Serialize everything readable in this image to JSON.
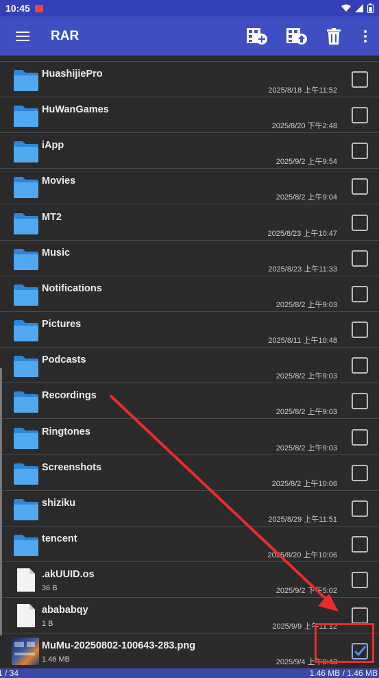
{
  "status_bar": {
    "time": "10:45"
  },
  "app_bar": {
    "title": "RAR",
    "actions": [
      "add-to-archive-icon",
      "extract-icon",
      "delete-icon",
      "more-vert-icon"
    ]
  },
  "files": [
    {
      "name": "HuashijiePro",
      "date": "2025/8/18 上午11:52",
      "size": "",
      "type": "folder",
      "checked": false
    },
    {
      "name": "HuWanGames",
      "date": "2025/8/20 下午2:48",
      "size": "",
      "type": "folder",
      "checked": false
    },
    {
      "name": "iApp",
      "date": "2025/9/2 上午9:54",
      "size": "",
      "type": "folder",
      "checked": false
    },
    {
      "name": "Movies",
      "date": "2025/8/2 上午9:04",
      "size": "",
      "type": "folder",
      "checked": false
    },
    {
      "name": "MT2",
      "date": "2025/8/23 上午10:47",
      "size": "",
      "type": "folder",
      "checked": false
    },
    {
      "name": "Music",
      "date": "2025/8/23 上午11:33",
      "size": "",
      "type": "folder",
      "checked": false
    },
    {
      "name": "Notifications",
      "date": "2025/8/2 上午9:03",
      "size": "",
      "type": "folder",
      "checked": false
    },
    {
      "name": "Pictures",
      "date": "2025/8/11 上午10:48",
      "size": "",
      "type": "folder",
      "checked": false
    },
    {
      "name": "Podcasts",
      "date": "2025/8/2 上午9:03",
      "size": "",
      "type": "folder",
      "checked": false
    },
    {
      "name": "Recordings",
      "date": "2025/8/2 上午9:03",
      "size": "",
      "type": "folder",
      "checked": false
    },
    {
      "name": "Ringtones",
      "date": "2025/8/2 上午9:03",
      "size": "",
      "type": "folder",
      "checked": false
    },
    {
      "name": "Screenshots",
      "date": "2025/8/2 上午10:06",
      "size": "",
      "type": "folder",
      "checked": false
    },
    {
      "name": "shiziku",
      "date": "2025/8/29 上午11:51",
      "size": "",
      "type": "folder",
      "checked": false
    },
    {
      "name": "tencent",
      "date": "2025/8/20 上午10:06",
      "size": "",
      "type": "folder",
      "checked": false
    },
    {
      "name": ".akUUID.os",
      "date": "2025/9/2 下午5:02",
      "size": "36 B",
      "type": "file",
      "checked": false
    },
    {
      "name": "abababqy",
      "date": "2025/9/9 上午11:12",
      "size": "1 B",
      "type": "file",
      "checked": false
    },
    {
      "name": "MuMu-20250802-100643-283.png",
      "date": "2025/9/4 上午9:43",
      "size": "1.46 MB",
      "type": "image",
      "checked": true
    }
  ],
  "bottom_bar": {
    "selection_count": "1 / 34",
    "selection_size": "1.46 MB / 1.46 MB"
  },
  "colors": {
    "app_bar": "#3f4fc2",
    "status_bar": "#3440b8",
    "folder": "#4fa8f0",
    "background": "#2b2b2b",
    "annotation": "#ee2b2b"
  }
}
